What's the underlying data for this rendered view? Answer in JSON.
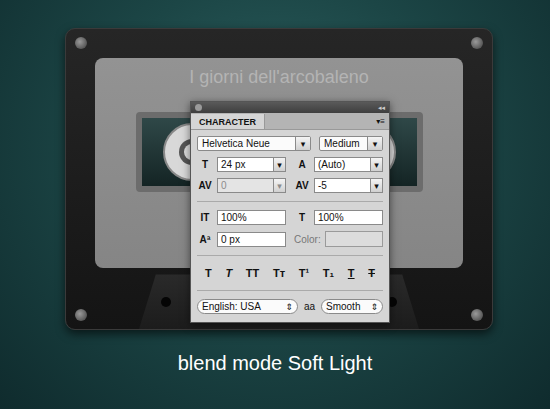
{
  "cassette": {
    "label": "I giorni dell'arcobaleno"
  },
  "panel": {
    "collapse": "◂◂",
    "tab": {
      "label": "CHARACTER",
      "selected": true
    },
    "menu": "▾≡",
    "dropdown_arrow": "▾",
    "stepper_arrow": "⇕",
    "font_family": "Helvetica Neue",
    "font_style": "Medium",
    "rows": [
      {
        "fields": [
          {
            "kind": "input",
            "icon": "T",
            "value": "24 px",
            "dropdown": true,
            "disabled": false
          },
          {
            "kind": "input",
            "icon": "A",
            "value": "(Auto)",
            "dropdown": true,
            "disabled": false
          }
        ]
      },
      {
        "fields": [
          {
            "kind": "input",
            "icon": "AV",
            "value": "0",
            "dropdown": true,
            "disabled": true
          },
          {
            "kind": "input",
            "icon": "AV",
            "value": "-5",
            "dropdown": true,
            "disabled": false
          }
        ]
      },
      {
        "fields": [
          {
            "kind": "input",
            "icon": "IT",
            "value": "100%",
            "dropdown": false,
            "disabled": false
          },
          {
            "kind": "input",
            "icon": "T",
            "value": "100%",
            "dropdown": false,
            "disabled": false
          }
        ]
      },
      {
        "fields": [
          {
            "kind": "input",
            "icon": "Aª",
            "value": "0 px",
            "dropdown": false,
            "disabled": false
          },
          {
            "kind": "color",
            "icon": "",
            "value": "Color:",
            "dropdown": false,
            "disabled": true
          }
        ]
      }
    ],
    "styles": [
      {
        "label": "T",
        "style": "bold",
        "selected": false
      },
      {
        "label": "T",
        "style": "italic",
        "selected": false
      },
      {
        "label": "TT",
        "style": "all-caps",
        "selected": false
      },
      {
        "label": "Tᴛ",
        "style": "small-caps",
        "selected": false
      },
      {
        "label": "T¹",
        "style": "superscript",
        "selected": false
      },
      {
        "label": "T₁",
        "style": "subscript",
        "selected": false
      },
      {
        "label": "T",
        "style": "underline",
        "selected": false
      },
      {
        "label": "T",
        "style": "strikethrough",
        "selected": false
      }
    ],
    "language": "English: USA",
    "antialias_icon": "aa",
    "antialias": "Smooth"
  },
  "caption": "blend mode Soft Light"
}
